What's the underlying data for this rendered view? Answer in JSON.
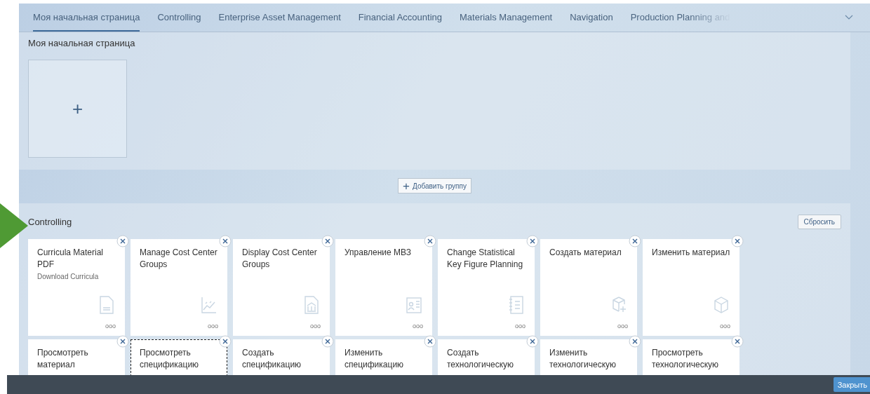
{
  "tabs": [
    {
      "label": "Моя начальная страница",
      "selected": true
    },
    {
      "label": "Controlling",
      "selected": false
    },
    {
      "label": "Enterprise Asset Management",
      "selected": false
    },
    {
      "label": "Financial Accounting",
      "selected": false
    },
    {
      "label": "Materials Management",
      "selected": false
    },
    {
      "label": "Navigation",
      "selected": false
    },
    {
      "label": "Production Planning and",
      "selected": false
    }
  ],
  "home_group": {
    "title": "Моя начальная страница",
    "add_tile": "+"
  },
  "add_group_button": {
    "icon": "+",
    "label": "Добавить группу"
  },
  "group": {
    "title": "Controlling",
    "reset_button": "Сбросить",
    "tile_rows": [
      [
        {
          "title": "Curricula Material PDF",
          "subtitle": "Download Curricula",
          "kind": "document",
          "more": "ooo",
          "focused": false
        },
        {
          "title": "Manage Cost Center Groups",
          "kind": "chart",
          "more": "ooo",
          "focused": false
        },
        {
          "title": "Display Cost Center Groups",
          "kind": "building",
          "more": "ooo",
          "focused": false
        },
        {
          "title": "Управление МВЗ",
          "kind": "card",
          "more": "ooo",
          "focused": false
        },
        {
          "title": "Change Statistical Key Figure Planning",
          "kind": "notebook",
          "more": "ooo",
          "focused": false
        },
        {
          "title": "Создать материал",
          "kind": "cube-plus",
          "more": "ooo",
          "focused": false
        },
        {
          "title": "Изменить материал",
          "kind": "cube",
          "more": "ooo",
          "focused": false
        }
      ],
      [
        {
          "title": "Просмотреть материал",
          "focused": false
        },
        {
          "title": "Просмотреть спецификацию",
          "focused": true
        },
        {
          "title": "Создать спецификацию",
          "focused": false
        },
        {
          "title": "Изменить спецификацию",
          "focused": false
        },
        {
          "title": "Создать технологическую",
          "focused": false
        },
        {
          "title": "Изменить технологическую",
          "focused": false
        },
        {
          "title": "Просмотреть технологическую",
          "focused": false
        }
      ]
    ]
  },
  "footer": {
    "close_button": "Закрыть"
  }
}
